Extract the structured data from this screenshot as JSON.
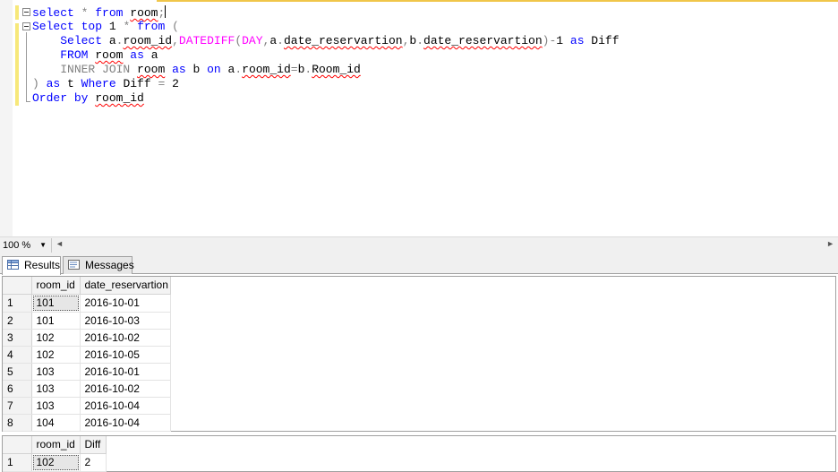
{
  "editor": {
    "lines": [
      {
        "tokens": [
          {
            "t": "select",
            "c": "kw"
          },
          {
            "t": " ",
            "c": "txt"
          },
          {
            "t": "*",
            "c": "gray"
          },
          {
            "t": " ",
            "c": "txt"
          },
          {
            "t": "from",
            "c": "kw"
          },
          {
            "t": " ",
            "c": "txt"
          },
          {
            "t": "room",
            "c": "txt",
            "sq": true
          },
          {
            "t": ";",
            "c": "gray"
          }
        ],
        "caret": true
      },
      {
        "tokens": [
          {
            "t": "Select",
            "c": "kw"
          },
          {
            "t": " ",
            "c": "txt"
          },
          {
            "t": "top",
            "c": "kw"
          },
          {
            "t": " 1 ",
            "c": "txt"
          },
          {
            "t": "*",
            "c": "gray"
          },
          {
            "t": " ",
            "c": "txt"
          },
          {
            "t": "from",
            "c": "kw"
          },
          {
            "t": " ",
            "c": "txt"
          },
          {
            "t": "(",
            "c": "gray"
          }
        ]
      },
      {
        "tokens": [
          {
            "t": "    ",
            "c": "txt"
          },
          {
            "t": "Select",
            "c": "kw"
          },
          {
            "t": " ",
            "c": "txt"
          },
          {
            "t": "a",
            "c": "txt"
          },
          {
            "t": ".",
            "c": "gray"
          },
          {
            "t": "room_id",
            "c": "txt",
            "sq": true
          },
          {
            "t": ",",
            "c": "gray"
          },
          {
            "t": "DATEDIFF",
            "c": "fn"
          },
          {
            "t": "(",
            "c": "gray"
          },
          {
            "t": "DAY",
            "c": "fn"
          },
          {
            "t": ",",
            "c": "gray"
          },
          {
            "t": "a",
            "c": "txt"
          },
          {
            "t": ".",
            "c": "gray"
          },
          {
            "t": "date_reservartion",
            "c": "txt",
            "sq": true
          },
          {
            "t": ",",
            "c": "gray"
          },
          {
            "t": "b",
            "c": "txt"
          },
          {
            "t": ".",
            "c": "gray"
          },
          {
            "t": "date_reservartion",
            "c": "txt",
            "sq": true
          },
          {
            "t": ")",
            "c": "gray"
          },
          {
            "t": "-",
            "c": "gray"
          },
          {
            "t": "1 ",
            "c": "txt"
          },
          {
            "t": "as",
            "c": "kw"
          },
          {
            "t": " Diff",
            "c": "txt"
          }
        ]
      },
      {
        "tokens": [
          {
            "t": "    ",
            "c": "txt"
          },
          {
            "t": "FROM",
            "c": "kw"
          },
          {
            "t": " ",
            "c": "txt"
          },
          {
            "t": "room",
            "c": "txt",
            "sq": true
          },
          {
            "t": " ",
            "c": "txt"
          },
          {
            "t": "as",
            "c": "kw"
          },
          {
            "t": " a",
            "c": "txt"
          }
        ]
      },
      {
        "tokens": [
          {
            "t": "    ",
            "c": "txt"
          },
          {
            "t": "INNER JOIN",
            "c": "gray"
          },
          {
            "t": " ",
            "c": "txt"
          },
          {
            "t": "room",
            "c": "txt",
            "sq": true
          },
          {
            "t": " ",
            "c": "txt"
          },
          {
            "t": "as",
            "c": "kw"
          },
          {
            "t": " b ",
            "c": "txt"
          },
          {
            "t": "on",
            "c": "kw"
          },
          {
            "t": " ",
            "c": "txt"
          },
          {
            "t": "a",
            "c": "txt"
          },
          {
            "t": ".",
            "c": "gray"
          },
          {
            "t": "room_id",
            "c": "txt",
            "sq": true
          },
          {
            "t": "=",
            "c": "gray"
          },
          {
            "t": "b",
            "c": "txt"
          },
          {
            "t": ".",
            "c": "gray"
          },
          {
            "t": "Room_id",
            "c": "txt",
            "sq": true
          }
        ]
      },
      {
        "tokens": [
          {
            "t": ")",
            "c": "gray"
          },
          {
            "t": " ",
            "c": "txt"
          },
          {
            "t": "as",
            "c": "kw"
          },
          {
            "t": " t ",
            "c": "txt"
          },
          {
            "t": "Where",
            "c": "kw"
          },
          {
            "t": " Diff ",
            "c": "txt"
          },
          {
            "t": "=",
            "c": "gray"
          },
          {
            "t": " 2",
            "c": "txt"
          }
        ]
      },
      {
        "tokens": [
          {
            "t": "Order",
            "c": "kw"
          },
          {
            "t": " ",
            "c": "txt"
          },
          {
            "t": "by",
            "c": "kw"
          },
          {
            "t": " ",
            "c": "txt"
          },
          {
            "t": "room_id",
            "c": "txt",
            "sq": true
          }
        ]
      }
    ]
  },
  "status": {
    "zoom": "100 %"
  },
  "tabs": {
    "results": "Results",
    "messages": "Messages"
  },
  "grid1": {
    "columns": [
      "room_id",
      "date_reservartion"
    ],
    "rows": [
      [
        "101",
        "2016-10-01"
      ],
      [
        "101",
        "2016-10-03"
      ],
      [
        "102",
        "2016-10-02"
      ],
      [
        "102",
        "2016-10-05"
      ],
      [
        "103",
        "2016-10-01"
      ],
      [
        "103",
        "2016-10-02"
      ],
      [
        "103",
        "2016-10-04"
      ],
      [
        "104",
        "2016-10-04"
      ]
    ]
  },
  "grid2": {
    "columns": [
      "room_id",
      "Diff"
    ],
    "rows": [
      [
        "102",
        "2"
      ]
    ]
  }
}
